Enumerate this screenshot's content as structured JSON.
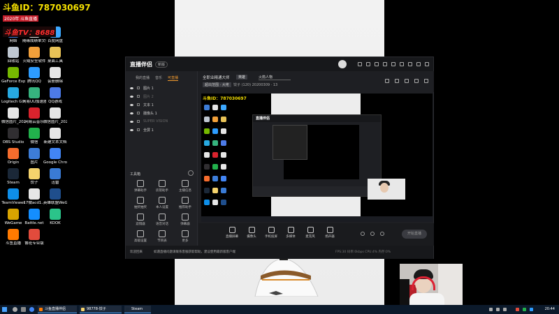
{
  "overlay": {
    "main": "斗鱼ID：787030697",
    "sub1": "2020年 斗鱼直播",
    "sub2": "斗鱼TV：8688"
  },
  "desktop_icons": [
    {
      "label": "网络",
      "color": "#3d7dd8"
    },
    {
      "label": "随缘成绩单文档",
      "color": "#e6e6e6"
    },
    {
      "label": "百度网盘",
      "color": "#3da9ff"
    },
    {
      "label": "回收站",
      "color": "#bfc7d1"
    },
    {
      "label": "火绒安全软件",
      "color": "#f2a03a"
    },
    {
      "label": "桌面工具",
      "color": "#e8c257"
    },
    {
      "label": "GeForce Experience",
      "color": "#76b900"
    },
    {
      "label": "腾讯QQ",
      "color": "#2d9cff"
    },
    {
      "label": "会册删除",
      "color": "#e6e6e6"
    },
    {
      "label": "Logitech G HUB",
      "color": "#27a9e1"
    },
    {
      "label": "网易UU加速器",
      "color": "#36b37e"
    },
    {
      "label": "QQ游戏",
      "color": "#4d7be8"
    },
    {
      "label": "微信图片_2022111",
      "color": "#e6e6e6"
    },
    {
      "label": "网易云音乐",
      "color": "#d9232d"
    },
    {
      "label": "微信图片_2022081",
      "color": "#e6e6e6"
    },
    {
      "label": "OBS Studio",
      "color": "#302e31"
    },
    {
      "label": "微信",
      "color": "#22b14c"
    },
    {
      "label": "新建文本文档",
      "color": "#e6e6e6"
    },
    {
      "label": "Origin",
      "color": "#f56c2d"
    },
    {
      "label": "图片",
      "color": "#3d7dd8"
    },
    {
      "label": "Google Chrome",
      "color": "#4285f4"
    },
    {
      "label": "Steam",
      "color": "#1b2838"
    },
    {
      "label": "饺子",
      "color": "#f5d36c"
    },
    {
      "label": "迅雷",
      "color": "#3a7bd5"
    },
    {
      "label": "TeamViewer",
      "color": "#0e8ee9"
    },
    {
      "label": "17微acd1...",
      "color": "#e6e6e6"
    },
    {
      "label": "英雄联盟WeGame版",
      "color": "#1f4e8c"
    },
    {
      "label": "WeGame",
      "color": "#d9a400"
    },
    {
      "label": "Battle.net",
      "color": "#148eff"
    },
    {
      "label": "KOOK",
      "color": "#2bc48a"
    },
    {
      "label": "斗鱼直播",
      "color": "#ff7a00"
    },
    {
      "label": "鲁班专业版",
      "color": "#e24b3c"
    }
  ],
  "app": {
    "logo": "直播伴侣",
    "version": "新版",
    "scene_tabs": [
      "我的直播",
      "音乐",
      "可直播"
    ],
    "active_tab_index": 2,
    "sources": [
      {
        "label": "图片 1",
        "dim": false
      },
      {
        "label": "图片 2",
        "dim": true
      },
      {
        "label": "文本 1",
        "dim": false
      },
      {
        "label": "摄像头 1",
        "dim": false
      },
      {
        "label": "SUPER VISION",
        "dim": true
      },
      {
        "label": "全屏 1",
        "dim": false
      }
    ],
    "tools_title": "工具箱",
    "tools": [
      {
        "label": "弹幕助手"
      },
      {
        "label": "房管助手"
      },
      {
        "label": "主播信息"
      },
      {
        "label": "抽奖抽奖"
      },
      {
        "label": "本人设置"
      },
      {
        "label": "推荐助手"
      },
      {
        "label": "滤镜器"
      },
      {
        "label": "语音对话"
      },
      {
        "label": "弹幕器"
      },
      {
        "label": "高级设置"
      },
      {
        "label": "节目表"
      },
      {
        "label": "更多"
      }
    ],
    "room": {
      "title": "全职业精通大师",
      "chip1": "英雄",
      "chip2": "火箭人物",
      "chip3": "超出范围 · 大佬",
      "meta": "饺子 (120) 20200309",
      "count": "13"
    },
    "preview_overlay": "斗鱼ID：787030697",
    "nested_title": "直播伴侣",
    "bottom_buttons": [
      {
        "label": "直播屏幕"
      },
      {
        "label": "摄像头"
      },
      {
        "label": "手机投屏"
      },
      {
        "label": "多媒体"
      },
      {
        "label": "麦克风"
      },
      {
        "label": "扬声器"
      }
    ],
    "start_live": "开始直播",
    "status_msg": "欢迎回来",
    "status_link": "如遇直播问题请联系客服获取帮助，建议使用最新版客户端",
    "status_stats": "FPS:30   码率:0kbps   CPU:4%   内存:0%"
  },
  "taskbar": {
    "apps": [
      {
        "label": "斗鱼直播伴侣",
        "color": "#ff7a00"
      },
      {
        "label": "98778-饺子",
        "color": "#f5d36c"
      },
      {
        "label": "Steam",
        "color": "#1b2838"
      }
    ],
    "clock": "20:44"
  }
}
